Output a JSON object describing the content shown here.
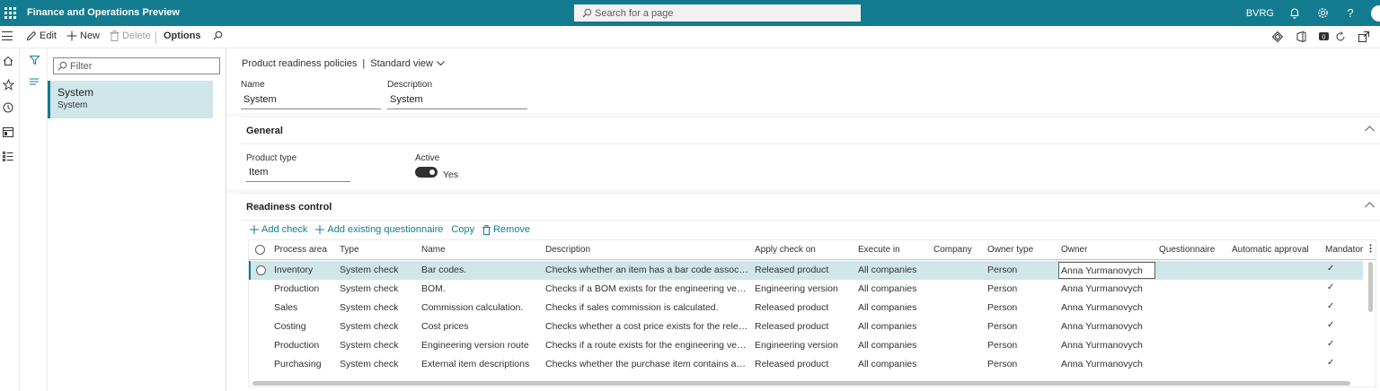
{
  "topbar": {
    "app_title": "Finance and Operations Preview",
    "search_placeholder": "Search for a page",
    "company": "BVRG",
    "help": "?"
  },
  "actionbar": {
    "edit": "Edit",
    "new": "New",
    "delete": "Delete",
    "options": "Options"
  },
  "list": {
    "filter_placeholder": "Filter",
    "items": [
      {
        "title": "System",
        "subtitle": "System"
      }
    ]
  },
  "details": {
    "breadcrumb": "Product readiness policies",
    "breadcrumb_sep": "|",
    "view": "Standard view",
    "name_label": "Name",
    "name_value": "System",
    "description_label": "Description",
    "description_value": "System",
    "general": {
      "title": "General",
      "product_type_label": "Product type",
      "product_type_value": "Item",
      "active_label": "Active",
      "active_value": "Yes",
      "active_on": true
    },
    "readiness": {
      "title": "Readiness control",
      "toolbar": {
        "add_check": "Add check",
        "add_existing": "Add existing questionnaire",
        "copy": "Copy",
        "remove": "Remove"
      },
      "columns": [
        "Process area",
        "Type",
        "Name",
        "Description",
        "Apply check on",
        "Execute in",
        "Company",
        "Owner type",
        "Owner",
        "Questionnaire",
        "Automatic approval",
        "Mandator"
      ],
      "rows": [
        {
          "process_area": "Inventory",
          "type": "System check",
          "name": "Bar codes.",
          "description": "Checks whether an item has a bar code associated.",
          "apply_check_on": "Released product",
          "execute_in": "All companies",
          "company": "",
          "owner_type": "Person",
          "owner": "Anna Yurmanovych",
          "questionnaire": "",
          "automatic_approval": "",
          "mandatory": "✓"
        },
        {
          "process_area": "Production",
          "type": "System check",
          "name": "BOM.",
          "description": "Checks if a BOM exists for the engineering version.",
          "apply_check_on": "Engineering version",
          "execute_in": "All companies",
          "company": "",
          "owner_type": "Person",
          "owner": "Anna Yurmanovych",
          "questionnaire": "",
          "automatic_approval": "",
          "mandatory": "✓"
        },
        {
          "process_area": "Sales",
          "type": "System check",
          "name": "Commission calculation.",
          "description": "Checks if sales commission is calculated.",
          "apply_check_on": "Released product",
          "execute_in": "All companies",
          "company": "",
          "owner_type": "Person",
          "owner": "Anna Yurmanovych",
          "questionnaire": "",
          "automatic_approval": "",
          "mandatory": "✓"
        },
        {
          "process_area": "Costing",
          "type": "System check",
          "name": "Cost prices",
          "description": "Checks whether a cost price exists for the released product.",
          "apply_check_on": "Released product",
          "execute_in": "All companies",
          "company": "",
          "owner_type": "Person",
          "owner": "Anna Yurmanovych",
          "questionnaire": "",
          "automatic_approval": "",
          "mandatory": "✓"
        },
        {
          "process_area": "Production",
          "type": "System check",
          "name": "Engineering version route",
          "description": "Checks if a route exists for the engineering version.",
          "apply_check_on": "Engineering version",
          "execute_in": "All companies",
          "company": "",
          "owner_type": "Person",
          "owner": "Anna Yurmanovych",
          "questionnaire": "",
          "automatic_approval": "",
          "mandatory": "✓"
        },
        {
          "process_area": "Purchasing",
          "type": "System check",
          "name": "External item descriptions",
          "description": "Checks whether the purchase item contains an external item description.",
          "apply_check_on": "Released product",
          "execute_in": "All companies",
          "company": "",
          "owner_type": "Person",
          "owner": "Anna Yurmanovych",
          "questionnaire": "",
          "automatic_approval": "",
          "mandatory": "✓"
        }
      ]
    }
  },
  "colors": {
    "brand": "#137b8f",
    "selected_row": "#d0e7ea"
  }
}
